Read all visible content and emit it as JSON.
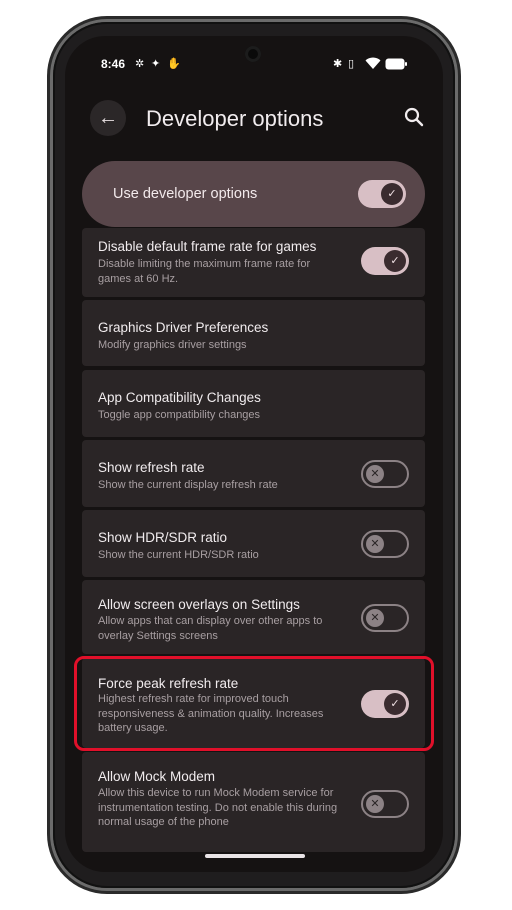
{
  "status_bar": {
    "time": "8:46",
    "left_icons": [
      "fan-icon",
      "pinwheel-icon",
      "hand-icon"
    ],
    "right_icons": [
      "bluetooth-icon",
      "vibrate-icon",
      "wifi-icon",
      "battery-icon"
    ]
  },
  "header": {
    "title": "Developer options",
    "back_icon": "arrow-left-icon",
    "search_icon": "search-icon"
  },
  "master_toggle": {
    "label": "Use developer options",
    "enabled": true
  },
  "settings": [
    {
      "title": "Disable default frame rate for games",
      "subtitle": "Disable limiting the maximum frame rate for games at 60 Hz.",
      "toggle": true
    },
    {
      "title": "Graphics Driver Preferences",
      "subtitle": "Modify graphics driver settings",
      "toggle": null
    },
    {
      "title": "App Compatibility Changes",
      "subtitle": "Toggle app compatibility changes",
      "toggle": null
    },
    {
      "title": "Show refresh rate",
      "subtitle": "Show the current display refresh rate",
      "toggle": false
    },
    {
      "title": "Show HDR/SDR ratio",
      "subtitle": "Show the current HDR/SDR ratio",
      "toggle": false
    },
    {
      "title": "Allow screen overlays on Settings",
      "subtitle": "Allow apps that can display over other apps to overlay Settings screens",
      "toggle": false
    },
    {
      "title": "Force peak refresh rate",
      "subtitle": "Highest refresh rate for improved touch responsiveness & animation quality. Increases battery usage.",
      "toggle": true
    },
    {
      "title": "Allow Mock Modem",
      "subtitle": "Allow this device to run Mock Modem service for instrumentation testing. Do not enable this during normal usage of the phone",
      "toggle": false
    }
  ],
  "colors": {
    "background": "#151212",
    "card": "#2a2526",
    "master_card": "#58464a",
    "toggle_on": "#d8bfc5",
    "highlight": "#e0102a"
  }
}
